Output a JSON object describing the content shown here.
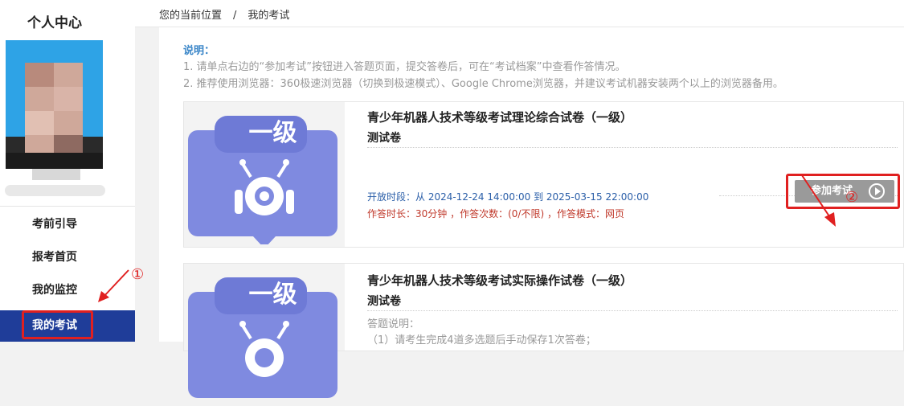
{
  "sidebar": {
    "title": "个人中心",
    "nav": [
      {
        "label": "考前引导"
      },
      {
        "label": "报考首页"
      },
      {
        "label": "我的监控"
      },
      {
        "label": "我的考试"
      }
    ],
    "annotation_marker": "①"
  },
  "breadcrumb": {
    "prefix": "您的当前位置",
    "separator": "/",
    "current": "我的考试"
  },
  "notice": {
    "heading": "说明：",
    "line1": "1. 请单点右边的“参加考试”按钮进入答题页面，提交答卷后，可在“考试档案”中查看作答情况。",
    "line2": "2. 推荐使用浏览器：360极速浏览器（切换到极速模式）、Google Chrome浏览器，并建议考试机器安装两个以上的浏览器备用。"
  },
  "exams": [
    {
      "badge_text": "一级",
      "title": "青少年机器人技术等级考试理论综合试卷（一级）",
      "subtitle": "测试卷",
      "open_period": "开放时段：从 2024-12-24 14:00:00 到 2025-03-15 22:00:00",
      "info": "作答时长：30分钟 ，作答次数：(0/不限) ，作答模式：网页",
      "join_label": "参加考试",
      "annotation_marker": "②"
    },
    {
      "badge_text": "一级",
      "title": "青少年机器人技术等级考试实际操作试卷（一级）",
      "subtitle": "测试卷",
      "desc_heading": "答题说明：",
      "desc_line1": "（1）请考生完成4道多选题后手动保存1次答卷；"
    }
  ],
  "colors": {
    "accent": "#1f3d99",
    "badge": "#7f8ae0",
    "badge_tab": "#6e7ad6",
    "annotation": "#e02020",
    "link_blue": "#2a5ea8",
    "info_red": "#c0392b",
    "button_gray": "#9a9a9a"
  }
}
